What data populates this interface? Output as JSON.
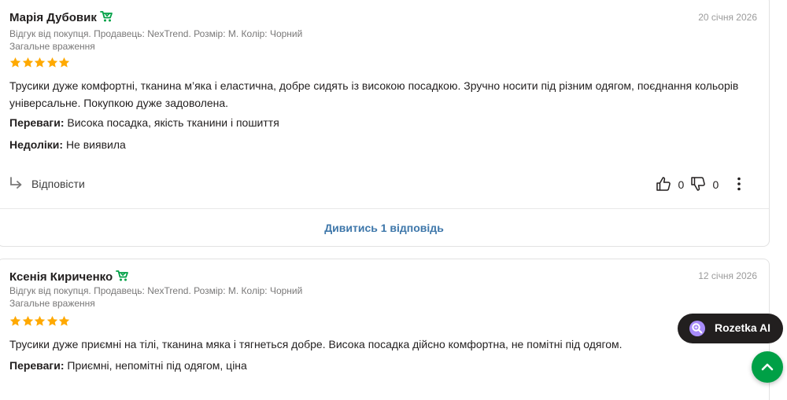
{
  "reviews": [
    {
      "author": "Марія Дубовик",
      "date": "20 січня 2026",
      "meta": "Відгук від покупця. Продавець: NexTrend. Розмір: M. Колір: Чорний",
      "overall_label": "Загальне враження",
      "rating": 5,
      "text": "Трусики дуже комфортні, тканина м’яка і еластична, добре сидять із високою посадкою. Зручно носити під різним одягом, поєднання кольорів універсальне. Покупкою дуже задоволена.",
      "pros_label": "Переваги:",
      "pros": "Висока посадка, якість тканини і пошиття",
      "cons_label": "Недоліки:",
      "cons": "Не виявила",
      "reply_label": "Відповісти",
      "likes": "0",
      "dislikes": "0",
      "show_replies": "Дивитись 1 відповідь"
    },
    {
      "author": "Ксенія Кириченко",
      "date": "12 січня 2026",
      "meta": "Відгук від покупця. Продавець: NexTrend. Розмір: M. Колір: Чорний",
      "overall_label": "Загальне враження",
      "rating": 5,
      "text": "Трусики дуже приємні на тілі, тканина мяка і тягнеться добре. Висока посадка дійсно комфортна, не помітні під одягом.",
      "pros_label": "Переваги:",
      "pros": "Приємні, непомітні під одягом, ціна"
    }
  ],
  "ai_button": {
    "label": "Rozetka AI"
  },
  "colors": {
    "star": "#ffa900",
    "badge": "#00a046",
    "link": "#3e77aa",
    "accent": "#00a046"
  }
}
